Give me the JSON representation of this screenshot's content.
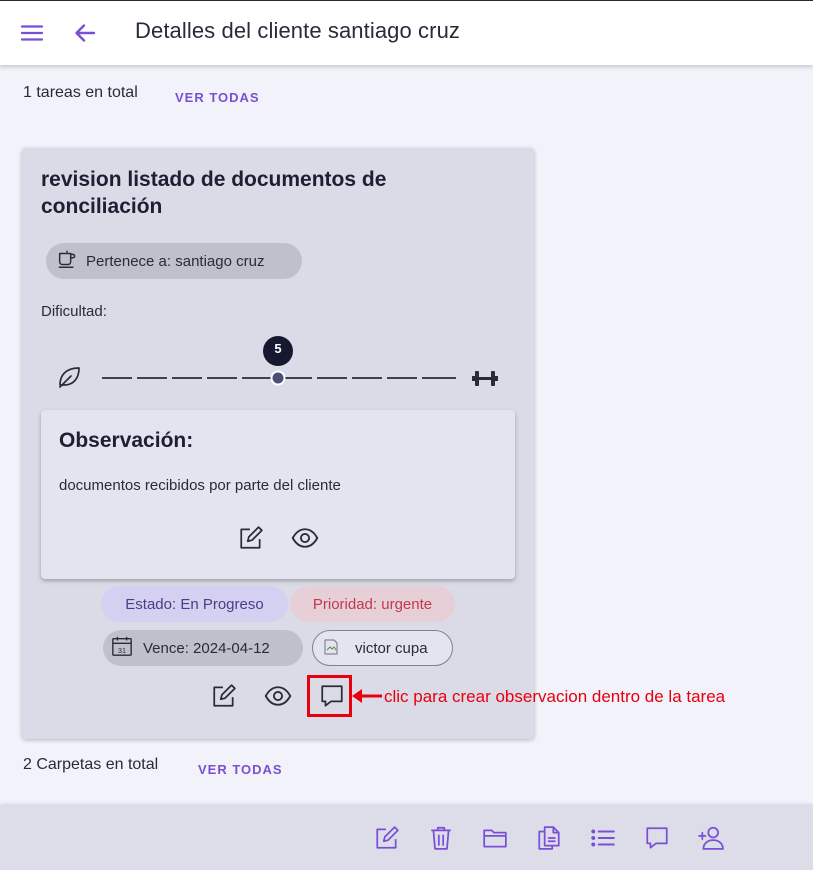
{
  "header": {
    "title": "Detalles del cliente santiago cruz",
    "menu_icon": "menu-icon",
    "back_icon": "arrow-left-icon"
  },
  "tasks_section": {
    "count_text": "1 tareas en total",
    "view_all_label": "VER TODAS"
  },
  "task_card": {
    "title": "revision listado de documentos de conciliación",
    "owner_chip": "Pertenece a: santiago cruz",
    "owner_icon": "coffee-cup-icon",
    "difficulty_label": "Dificultad:",
    "difficulty_value": "5",
    "difficulty_min_icon": "leaf-icon",
    "difficulty_max_icon": "dumbbell-icon",
    "observation": {
      "title": "Observación:",
      "text": "documentos recibidos por parte del cliente"
    },
    "status_chip": "Estado: En Progreso",
    "priority_chip": "Prioridad: urgente",
    "due_chip": "Vence: 2024-04-12",
    "due_icon": "calendar-icon",
    "assignee_chip": "victor cupa"
  },
  "annotation": {
    "text": "clic para  crear observacion dentro de la tarea"
  },
  "folders_section": {
    "count_text": "2 Carpetas en total",
    "view_all_label": "VER TODAS"
  },
  "bottom_toolbar": {
    "icons": [
      "edit-icon",
      "trash-icon",
      "folder-icon",
      "copy-icon",
      "list-icon",
      "comment-icon",
      "add-user-icon"
    ]
  },
  "colors": {
    "accent": "#7a4fd6",
    "annotation_red": "#e8000f",
    "priority_red": "#c03a4c",
    "card_background": "#dadbe7"
  }
}
